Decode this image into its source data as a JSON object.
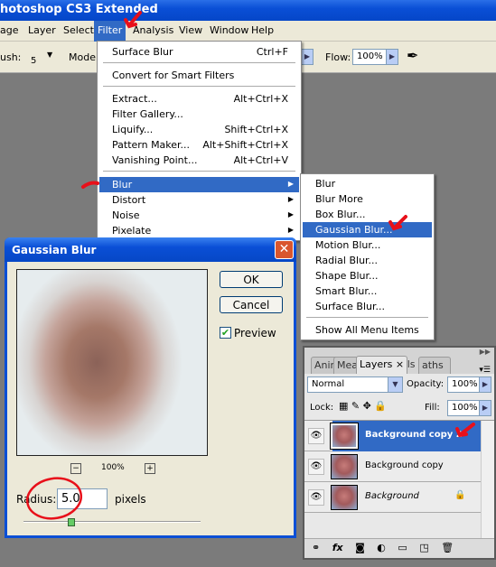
{
  "app": {
    "title": "hotoshop CS3 Extended"
  },
  "menubar": {
    "items": [
      "age",
      "Layer",
      "Select",
      "Filter",
      "Analysis",
      "View",
      "Window",
      "Help"
    ]
  },
  "options": {
    "brush_label": "ush:",
    "brush_size": "5",
    "mode_label": "Mode:",
    "flow_label": "Flow:",
    "flow_value": "100%"
  },
  "filter_menu": {
    "items": [
      {
        "label": "Surface Blur",
        "shortcut": "Ctrl+F"
      },
      {
        "label": "Convert for Smart Filters",
        "shortcut": ""
      },
      {
        "label": "Extract...",
        "shortcut": "Alt+Ctrl+X"
      },
      {
        "label": "Filter Gallery...",
        "shortcut": ""
      },
      {
        "label": "Liquify...",
        "shortcut": "Shift+Ctrl+X"
      },
      {
        "label": "Pattern Maker...",
        "shortcut": "Alt+Shift+Ctrl+X"
      },
      {
        "label": "Vanishing Point...",
        "shortcut": "Alt+Ctrl+V"
      },
      {
        "label": "Blur",
        "shortcut": ""
      },
      {
        "label": "Distort",
        "shortcut": ""
      },
      {
        "label": "Noise",
        "shortcut": ""
      },
      {
        "label": "Pixelate",
        "shortcut": ""
      }
    ]
  },
  "blur_submenu": {
    "items": [
      "Blur",
      "Blur More",
      "Box Blur...",
      "Gaussian Blur...",
      "Motion Blur...",
      "Radial Blur...",
      "Shape Blur...",
      "Smart Blur...",
      "Surface Blur...",
      "Show All Menu Items"
    ]
  },
  "dialog": {
    "title": "Gaussian Blur",
    "ok": "OK",
    "cancel": "Cancel",
    "preview_label": "Preview",
    "preview_checked": true,
    "zoom": "100%",
    "radius_label": "Radius:",
    "radius_value": "5.0",
    "radius_unit": "pixels",
    "zoom_out": "−",
    "zoom_in": "+"
  },
  "layers": {
    "tabs": [
      "Anim",
      "Mea",
      "Layers ×",
      "nels",
      "aths"
    ],
    "blend_mode": "Normal",
    "opacity_label": "Opacity:",
    "opacity": "100%",
    "lock_label": "Lock:",
    "fill_label": "Fill:",
    "fill": "100%",
    "rows": [
      {
        "name": "Background copy 2",
        "selected": true
      },
      {
        "name": "Background copy",
        "selected": false
      },
      {
        "name": "Background",
        "selected": false
      }
    ],
    "footer_icons": [
      "link-icon",
      "fx-icon",
      "mask-icon",
      "adjustment-icon",
      "folder-icon",
      "new-layer-icon",
      "trash-icon"
    ]
  },
  "colors": {
    "selection": "#316ac5",
    "annotation": "#e8101a"
  }
}
